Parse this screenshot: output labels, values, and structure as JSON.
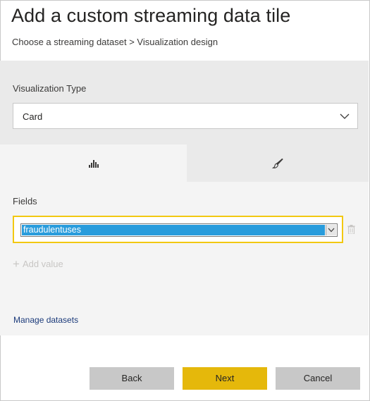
{
  "dialog": {
    "title": "Add a custom streaming data tile",
    "breadcrumb": "Choose a streaming dataset > Visualization design"
  },
  "visualization": {
    "label": "Visualization Type",
    "selected": "Card"
  },
  "tabs": [
    {
      "icon": "bar-chart-icon",
      "selected": true
    },
    {
      "icon": "paintbrush-icon",
      "selected": false
    }
  ],
  "fields": {
    "label": "Fields",
    "selected": "fraudulentuses",
    "add_value": "Add value"
  },
  "manage_datasets": "Manage datasets",
  "buttons": {
    "back": "Back",
    "next": "Next",
    "cancel": "Cancel"
  },
  "colors": {
    "accent": "#e5b80b",
    "focus_border": "#f2c811",
    "selection": "#299cdc",
    "link": "#1b3a7a"
  }
}
